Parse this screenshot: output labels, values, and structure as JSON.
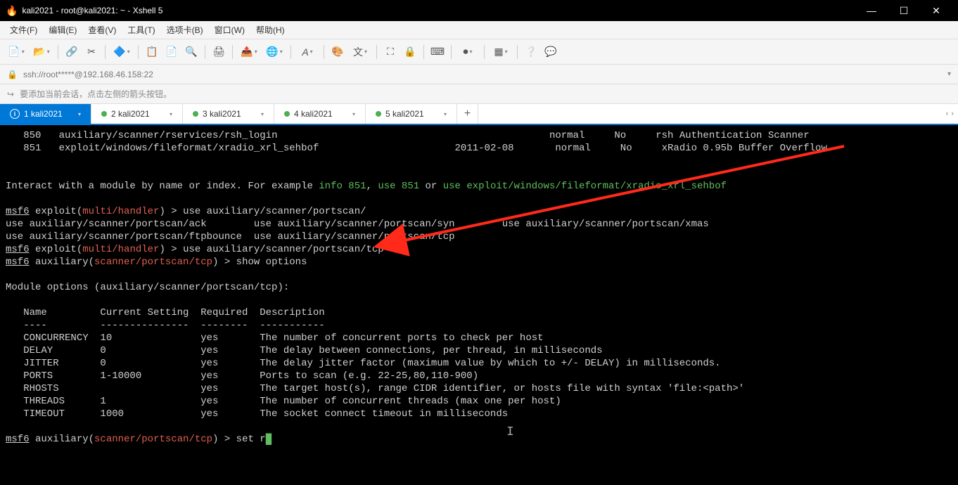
{
  "window": {
    "title": "kali2021 - root@kali2021: ~ - Xshell 5"
  },
  "menu": {
    "file": "文件(F)",
    "edit": "编辑(E)",
    "view": "查看(V)",
    "tools": "工具(T)",
    "tabs": "选项卡(B)",
    "window": "窗口(W)",
    "help": "帮助(H)"
  },
  "address": {
    "text": "ssh://root*****@192.168.46.158:22"
  },
  "info": {
    "text": "要添加当前会话，点击左侧的箭头按钮。"
  },
  "tabs": {
    "active": "1 kali2021",
    "t2": "2 kali2021",
    "t3": "3 kali2021",
    "t4": "4 kali2021",
    "t5": "5 kali2021"
  },
  "term": {
    "l1_num": "   850   ",
    "l1_mod": "auxiliary/scanner/rservices/rsh_login",
    "l1_rank": "normal",
    "l1_check": "No",
    "l1_desc": "rsh Authentication Scanner",
    "l2_num": "   851   ",
    "l2_mod": "exploit/windows/fileformat/xradio_xrl_sehbof",
    "l2_date": "2011-02-08",
    "l2_rank": "normal",
    "l2_check": "No",
    "l2_desc": "xRadio 0.95b Buffer Overflow",
    "interact": "Interact with a module by name or index. For example ",
    "info851": "info 851",
    "comma": ", ",
    "use851": "use 851",
    "or": " or ",
    "usepath": "use exploit/windows/fileformat/xradio_xrl_sehbof",
    "p_msf": "msf6",
    "p_exploit": " exploit(",
    "p_multi": "multi/handler",
    "p_close": ") > ",
    "cmd1": "use auxiliary/scanner/portscan/",
    "comp_l1a": "use auxiliary/scanner/portscan/ack        ",
    "comp_l1b": "use auxiliary/scanner/portscan/syn        ",
    "comp_l1c": "use auxiliary/scanner/portscan/xmas",
    "comp_l2a": "use auxiliary/scanner/portscan/ftpbounce  ",
    "comp_l2b": "use auxiliary/scanner/portscan/tcp",
    "cmd2": "use auxiliary/scanner/portscan/tcp",
    "p_aux": " auxiliary(",
    "p_scan": "scanner/portscan/tcp",
    "cmd3": "show options",
    "mod_opts": "Module options (auxiliary/scanner/portscan/tcp):",
    "hdr": "   Name         Current Setting  Required  Description",
    "hdr2": "   ----         ---------------  --------  -----------",
    "r1": "   CONCURRENCY  10               yes       The number of concurrent ports to check per host",
    "r2": "   DELAY        0                yes       The delay between connections, per thread, in milliseconds",
    "r3": "   JITTER       0                yes       The delay jitter factor (maximum value by which to +/- DELAY) in milliseconds.",
    "r4": "   PORTS        1-10000          yes       Ports to scan (e.g. 22-25,80,110-900)",
    "r5": "   RHOSTS                        yes       The target host(s), range CIDR identifier, or hosts file with syntax 'file:<path>'",
    "r6": "   THREADS      1                yes       The number of concurrent threads (max one per host)",
    "r7": "   TIMEOUT      1000             yes       The socket connect timeout in milliseconds",
    "cmd4": "set r"
  }
}
